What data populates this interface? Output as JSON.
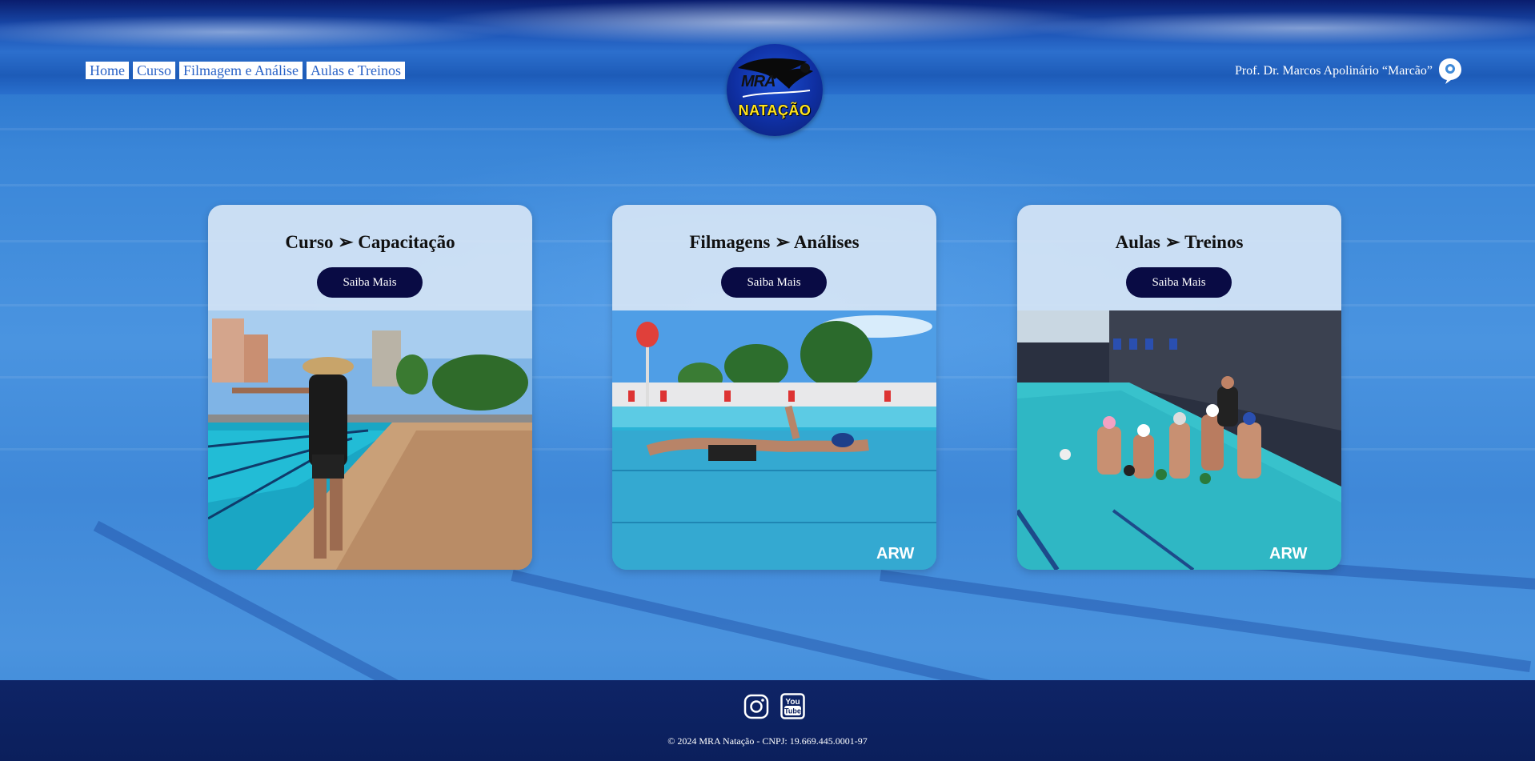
{
  "header": {
    "nav": [
      {
        "label": "Home"
      },
      {
        "label": "Curso"
      },
      {
        "label": "Filmagem e Análise"
      },
      {
        "label": "Aulas e Treinos"
      }
    ],
    "logo": {
      "top_text": "MRA",
      "bottom_text": "NATAÇÃO"
    },
    "professor": "Prof. Dr. Marcos Apolinário “Marcão”",
    "professor_icon": "chat-profile-icon"
  },
  "cards": [
    {
      "title": "Curso ➢ Capacitação",
      "button": "Saiba Mais",
      "image": "coach-at-pool-photo"
    },
    {
      "title": "Filmagens ➢ Análises",
      "button": "Saiba Mais",
      "image": "swimmer-underwater-photo"
    },
    {
      "title": "Aulas ➢ Treinos",
      "button": "Saiba Mais",
      "image": "swim-team-group-photo"
    }
  ],
  "footer": {
    "social": [
      {
        "icon": "instagram-icon"
      },
      {
        "icon": "youtube-icon"
      }
    ],
    "copyright": "© 2024 MRA Natação - CNPJ: 19.669.445.0001-97"
  },
  "colors": {
    "button_bg": "#090b44",
    "nav_text": "#2a63c7",
    "footer_bg": "#0b1f5c",
    "logo_yellow": "#ffe31a"
  }
}
